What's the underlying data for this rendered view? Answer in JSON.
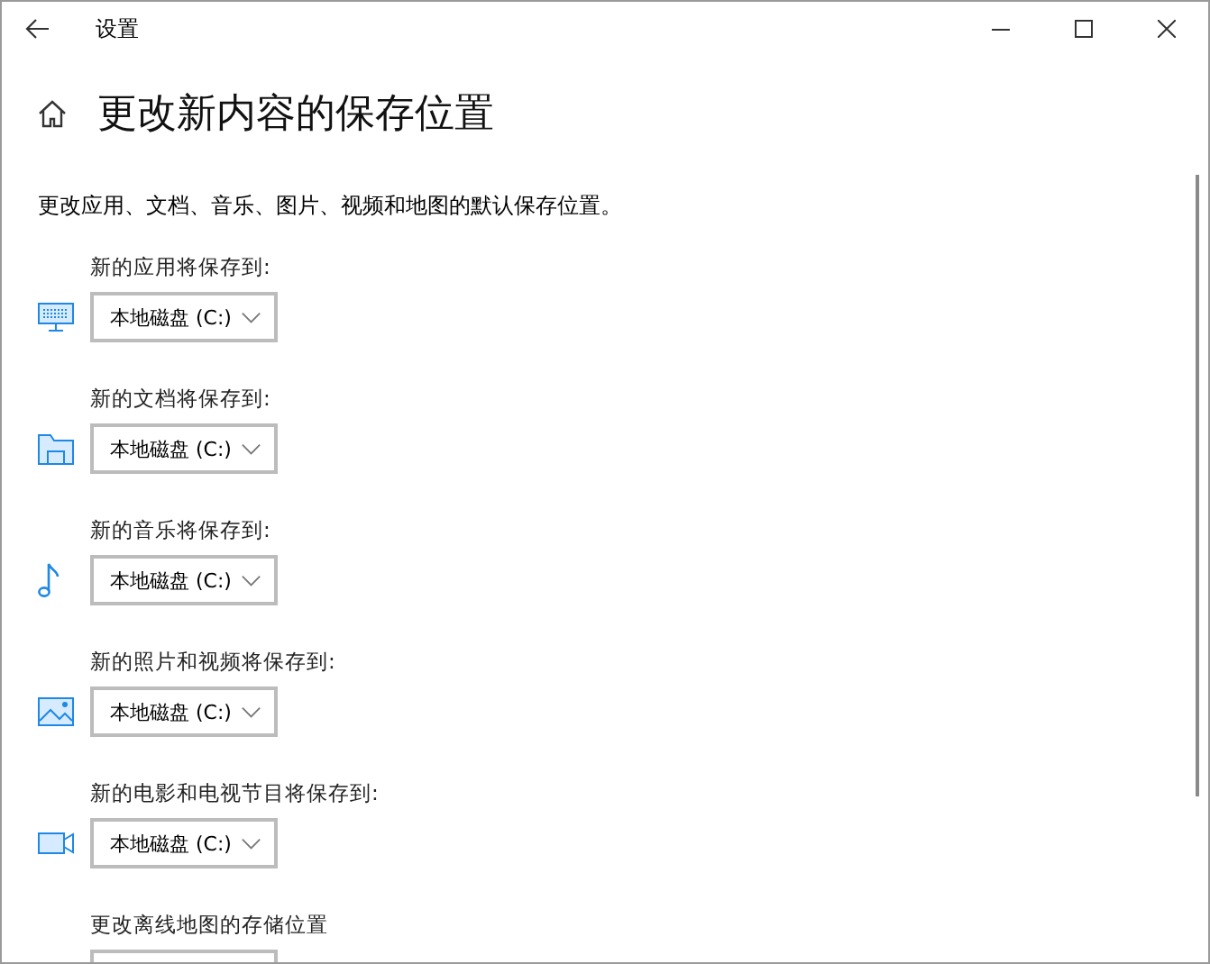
{
  "window": {
    "title": "设置"
  },
  "page": {
    "title": "更改新内容的保存位置",
    "description": "更改应用、文档、音乐、图片、视频和地图的默认保存位置。"
  },
  "sections": [
    {
      "kind": "apps",
      "label": "新的应用将保存到:",
      "value": "本地磁盘 (C:)"
    },
    {
      "kind": "documents",
      "label": "新的文档将保存到:",
      "value": "本地磁盘 (C:)"
    },
    {
      "kind": "music",
      "label": "新的音乐将保存到:",
      "value": "本地磁盘 (C:)"
    },
    {
      "kind": "photos",
      "label": "新的照片和视频将保存到:",
      "value": "本地磁盘 (C:)"
    },
    {
      "kind": "movies",
      "label": "新的电影和电视节目将保存到:",
      "value": "本地磁盘 (C:)"
    },
    {
      "kind": "maps",
      "label": "更改离线地图的存储位置"
    }
  ]
}
